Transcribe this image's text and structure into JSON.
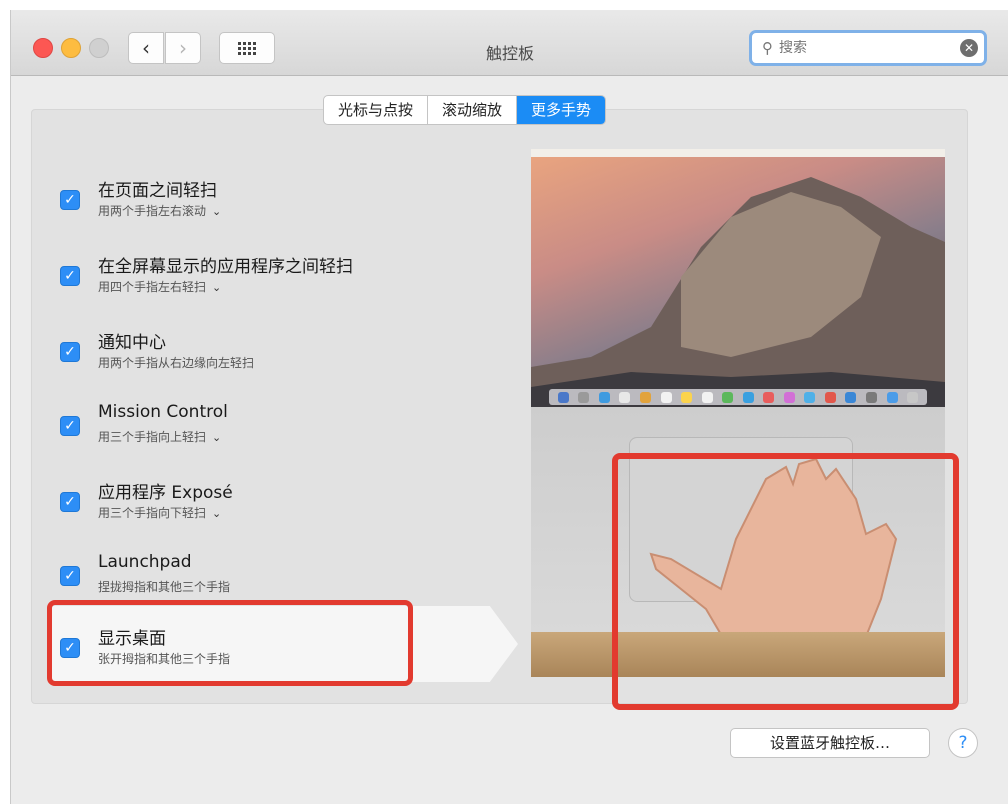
{
  "window": {
    "title": "触控板"
  },
  "toolbar": {
    "back_icon": "chevron-left-icon",
    "forward_icon": "chevron-right-icon",
    "grid_icon": "show-all-grid-icon"
  },
  "search": {
    "placeholder": "搜索",
    "value": ""
  },
  "tabs": [
    {
      "label": "光标与点按",
      "active": false
    },
    {
      "label": "滚动缩放",
      "active": false
    },
    {
      "label": "更多手势",
      "active": true
    }
  ],
  "gestures": [
    {
      "title": "在页面之间轻扫",
      "subtitle": "用两个手指左右滚动",
      "checked": true,
      "has_menu": true
    },
    {
      "title": "在全屏幕显示的应用程序之间轻扫",
      "subtitle": "用四个手指左右轻扫",
      "checked": true,
      "has_menu": true
    },
    {
      "title": "通知中心",
      "subtitle": "用两个手指从右边缘向左轻扫",
      "checked": true,
      "has_menu": false
    },
    {
      "title": "Mission Control",
      "subtitle": "用三个手指向上轻扫",
      "checked": true,
      "has_menu": true
    },
    {
      "title": "应用程序 Exposé",
      "subtitle": "用三个手指向下轻扫",
      "checked": true,
      "has_menu": true
    },
    {
      "title": "Launchpad",
      "subtitle": "捏拢拇指和其他三个手指",
      "checked": true,
      "has_menu": false
    },
    {
      "title": "显示桌面",
      "subtitle": "张开拇指和其他三个手指",
      "checked": true,
      "has_menu": false
    }
  ],
  "bluetooth_button": "设置蓝牙触控板…",
  "help_label": "?",
  "colors": {
    "accent": "#1b8cf5",
    "highlight": "#e23a2f"
  }
}
